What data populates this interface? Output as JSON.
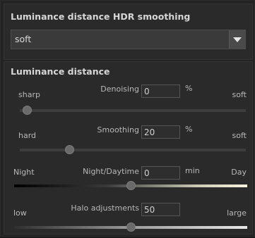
{
  "section1": {
    "title": "Luminance distance HDR smoothing",
    "dropdown_value": "soft"
  },
  "section2": {
    "title": "Luminance distance",
    "sliders": [
      {
        "left": "sharp",
        "right": "soft",
        "label": "Denoising",
        "value": "0",
        "unit": "%",
        "level": 0.03
      },
      {
        "left": "hard",
        "right": "soft",
        "label": "Smoothing",
        "value": "20",
        "unit": "%",
        "level": 0.22
      },
      {
        "left": "Night",
        "right": "Day",
        "label": "Night/Daytime",
        "value": "0",
        "unit": "min",
        "level": 0.5
      },
      {
        "left": "low",
        "right": "large",
        "label": "Halo adjustments",
        "value": "50",
        "unit": "",
        "level": 0.5
      }
    ]
  }
}
